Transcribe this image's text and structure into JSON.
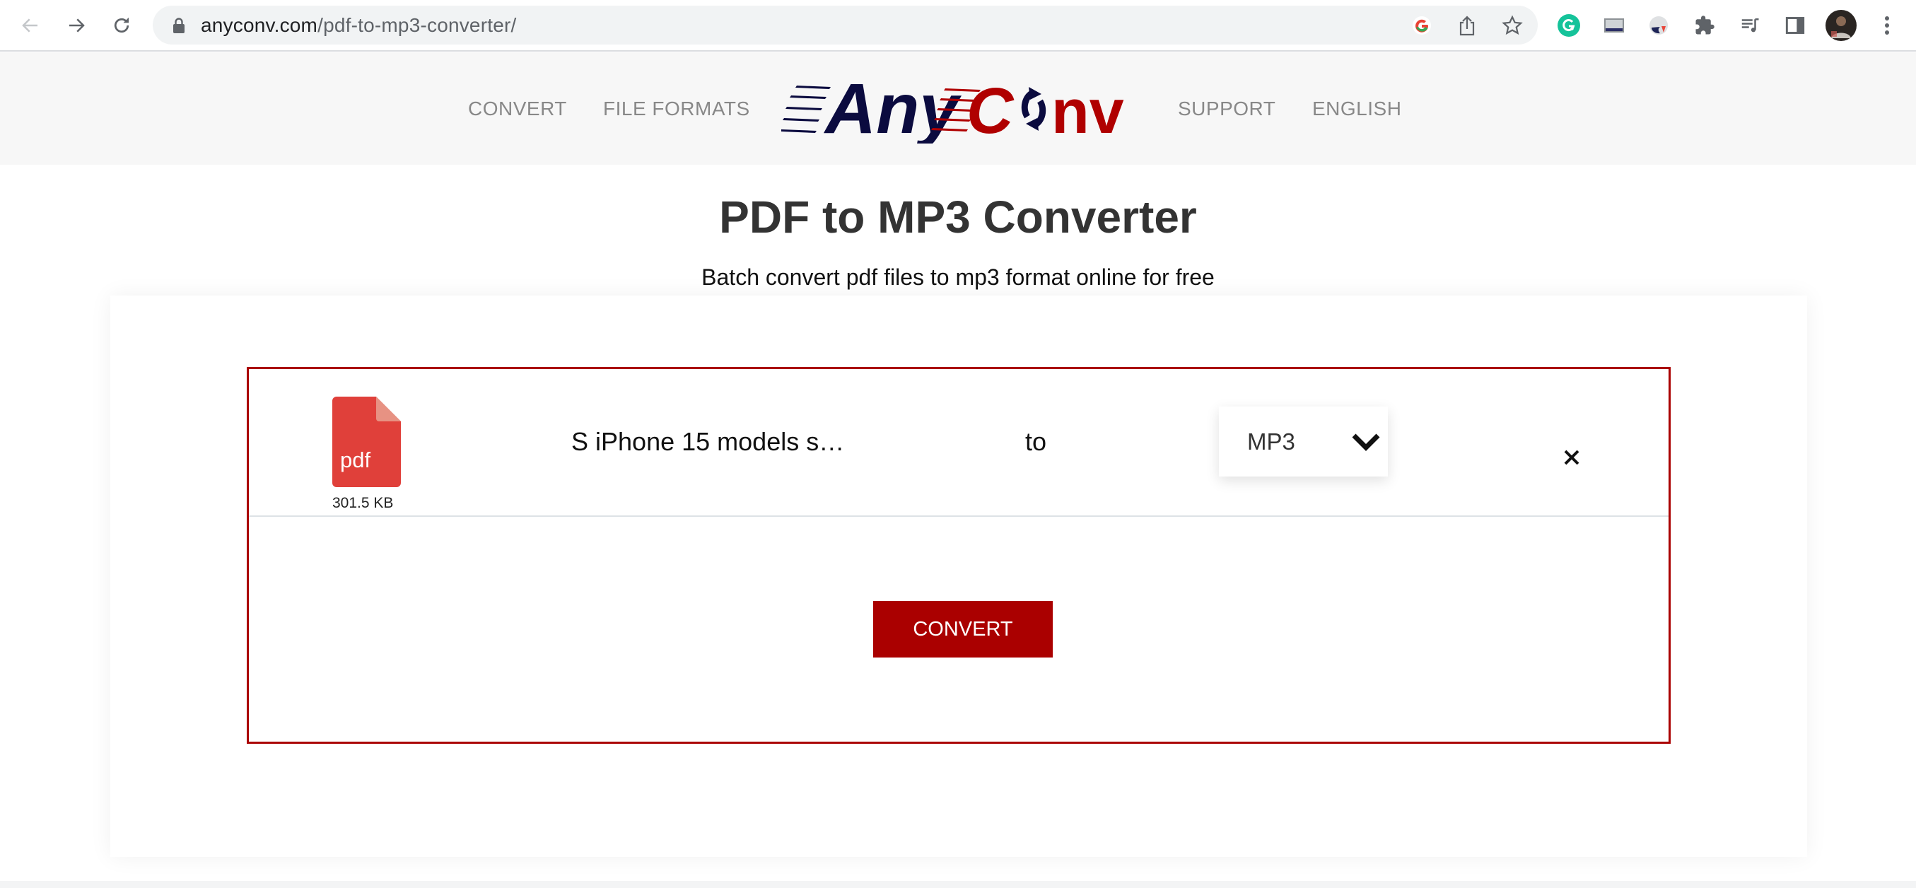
{
  "browser": {
    "url_host": "anyconv.com",
    "url_path": "/pdf-to-mp3-converter/",
    "nav_icons": [
      "back-arrow-icon",
      "forward-arrow-icon",
      "reload-icon"
    ],
    "omnibox_icons": [
      "google-icon",
      "share-icon",
      "bookmark-star-icon"
    ],
    "extension_icons": [
      "grammarly-icon",
      "image-extension-icon",
      "extension-icon",
      "puzzle-icon",
      "media-control-icon",
      "side-panel-icon",
      "profile-avatar",
      "menu-dots-icon"
    ],
    "colors": {
      "grammarly": "#15c39a",
      "toolbar_icon": "#5f6368"
    }
  },
  "header": {
    "nav_left": [
      "CONVERT",
      "FILE FORMATS"
    ],
    "nav_right": [
      "SUPPORT",
      "ENGLISH"
    ],
    "logo": {
      "part1": "Any",
      "part2": "C",
      "part3": "nv",
      "color_navy": "#0b0b3f",
      "color_red": "#b00000"
    }
  },
  "hero": {
    "title": "PDF to MP3 Converter",
    "subtitle": "Batch convert pdf files to mp3 format online for free"
  },
  "converter": {
    "file": {
      "icon_label": "pdf",
      "size": "301.5 KB",
      "name": "S iPhone 15 models s…"
    },
    "to_label": "to",
    "target_format": "MP3",
    "convert_label": "CONVERT",
    "colors": {
      "accent": "#aa0000",
      "pdf_icon": "#e0403a",
      "pdf_fold": "#e79283"
    }
  }
}
